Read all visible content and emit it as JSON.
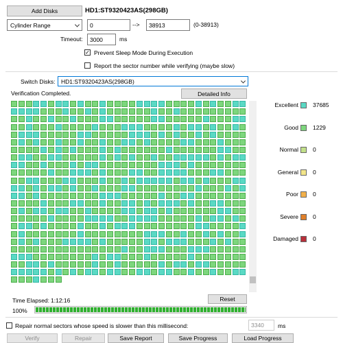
{
  "top": {
    "add_disks": "Add Disks",
    "disk_title": "HD1:ST9320423AS(298GB)",
    "range_mode": "Cylinder Range",
    "range_start": "0",
    "range_arrow": "-->",
    "range_end": "38913",
    "range_hint": "(0-38913)",
    "timeout_label": "Timeout:",
    "timeout_value": "3000",
    "timeout_unit": "ms",
    "prevent_sleep_label": "Prevent Sleep Mode During Execution",
    "prevent_sleep_checked": true,
    "report_sector_label": "Report the sector number while verifying (maybe slow)",
    "report_sector_checked": false
  },
  "panel": {
    "switch_disks_label": "Switch Disks:",
    "switch_disks_value": "HD1:ST9320423AS(298GB)",
    "status": "Verification Completed.",
    "detailed_info": "Detailed Info"
  },
  "legend": [
    {
      "label": "Excellent",
      "count": "37685",
      "color": "#5ad9c4"
    },
    {
      "label": "Good",
      "count": "1229",
      "color": "#7dd67d"
    },
    {
      "label": "Normal",
      "count": "0",
      "color": "#c2e08a"
    },
    {
      "label": "General",
      "count": "0",
      "color": "#f2e58a"
    },
    {
      "label": "Poor",
      "count": "0",
      "color": "#f2b04a"
    },
    {
      "label": "Severe",
      "count": "0",
      "color": "#e0802a"
    },
    {
      "label": "Damaged",
      "count": "0",
      "color": "#b8303a"
    }
  ],
  "grid": {
    "cols": 32,
    "rows": 24,
    "last_row_cells": 7,
    "excellent_color": "#5ad9c4",
    "good_color": "#7dd67d"
  },
  "time": {
    "elapsed_label": "Time Elapsed:",
    "elapsed_value": "1:12:16",
    "reset": "Reset",
    "progress_text": "100%",
    "progress_value": 1.0
  },
  "bottom": {
    "repair_label": "Repair normal sectors whose speed is slower than this millisecond:",
    "repair_checked": false,
    "repair_ms_value": "3340",
    "repair_ms_unit": "ms",
    "verify": "Verify",
    "repair": "Repair",
    "save_report": "Save Report",
    "save_progress": "Save Progress",
    "load_progress": "Load Progress"
  }
}
